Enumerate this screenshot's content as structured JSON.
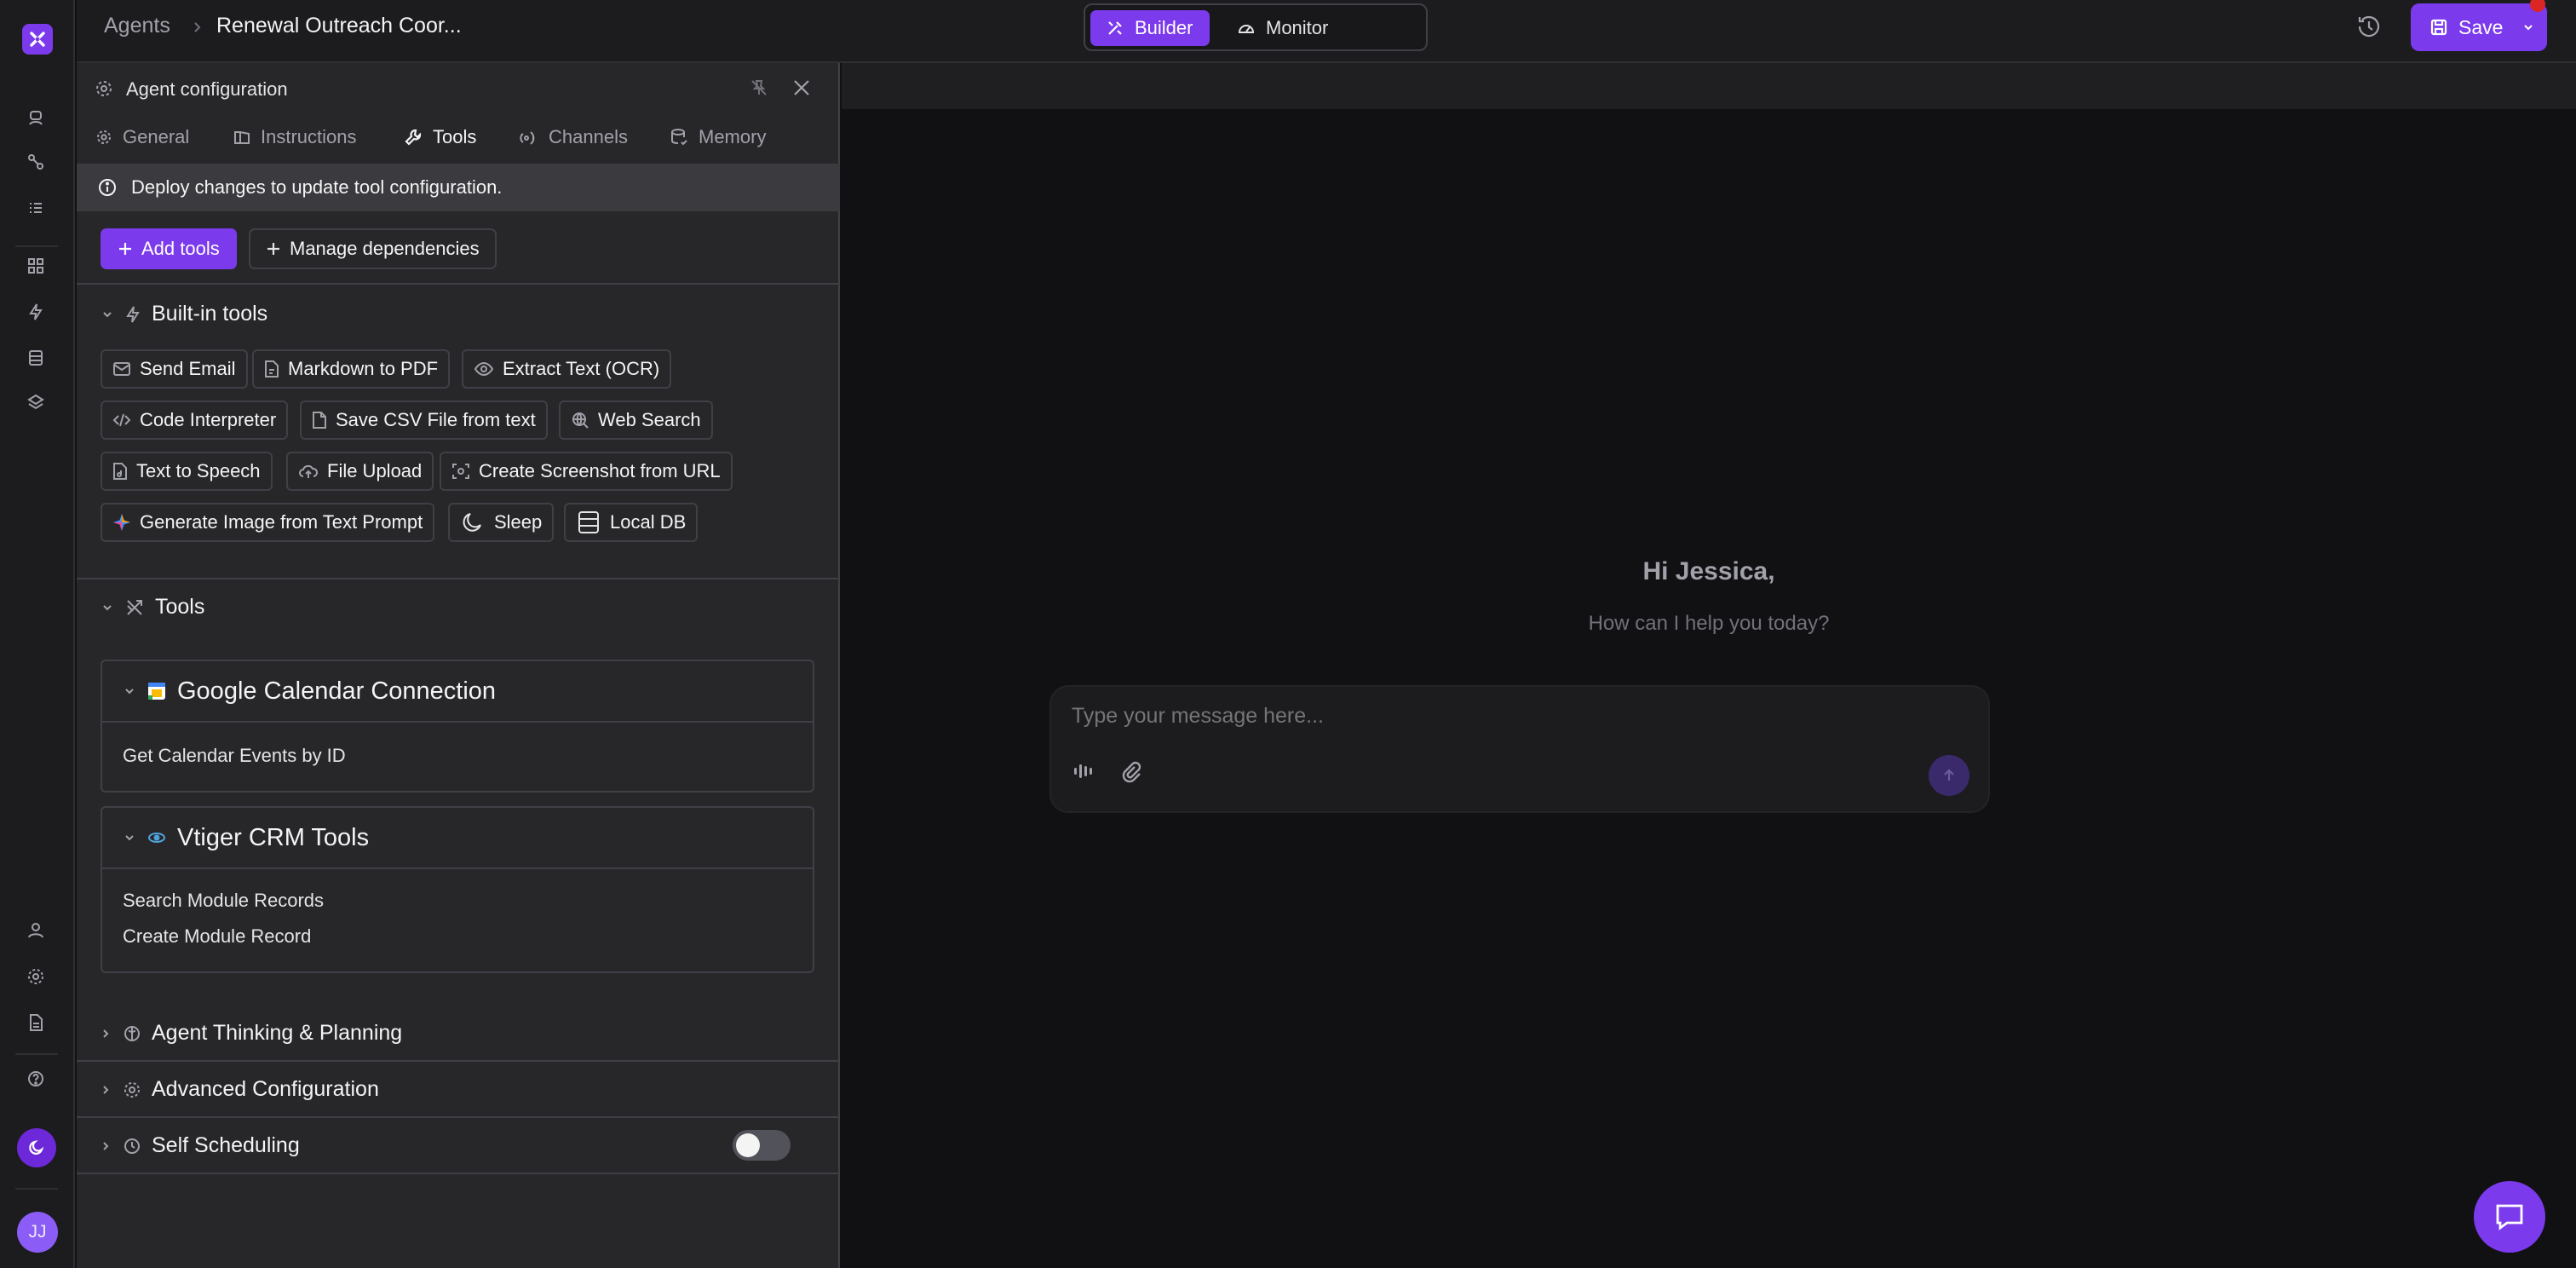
{
  "breadcrumb": {
    "root": "Agents",
    "current": "Renewal Outreach Coor..."
  },
  "mode_switch": {
    "builder": "Builder",
    "monitor": "Monitor"
  },
  "save_label": "Save",
  "user_initials": "JJ",
  "panel": {
    "title": "Agent configuration",
    "tabs": [
      "General",
      "Instructions",
      "Tools",
      "Channels",
      "Memory"
    ],
    "active_tab": "Tools",
    "banner": "Deploy changes to update tool configuration.",
    "add_tools": "Add tools",
    "manage_dependencies": "Manage dependencies",
    "builtin_title": "Built-in tools",
    "builtin_tools": [
      "Send Email",
      "Markdown to PDF",
      "Extract Text (OCR)",
      "Code Interpreter",
      "Save CSV File from text",
      "Web Search",
      "Text to Speech",
      "File Upload",
      "Create Screenshot from URL",
      "Generate Image from Text Prompt",
      "Sleep",
      "Local DB"
    ],
    "tools_title": "Tools",
    "connections": [
      {
        "name": "Google Calendar Connection",
        "items": [
          "Get Calendar Events by ID"
        ]
      },
      {
        "name": "Vtiger CRM Tools",
        "items": [
          "Search Module Records",
          "Create Module Record"
        ]
      }
    ],
    "sections": [
      "Agent Thinking & Planning",
      "Advanced Configuration",
      "Self Scheduling"
    ],
    "self_scheduling_enabled": false
  },
  "chat": {
    "greeting": "Hi Jessica,",
    "subtitle": "How can I help you today?",
    "placeholder": "Type your message here..."
  },
  "colors": {
    "accent": "#7c3aed",
    "panel": "#27272a",
    "background": "#111113"
  }
}
